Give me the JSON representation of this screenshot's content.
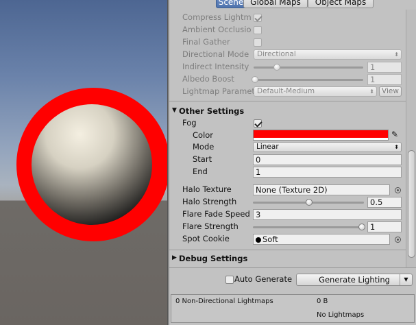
{
  "tabs": {
    "scene": "Scene",
    "global_maps": "Global Maps",
    "object_maps": "Object Maps"
  },
  "lightmapping": {
    "compress_lightmaps": {
      "label": "Compress Lightm",
      "checked": true
    },
    "ambient_occlusion": {
      "label": "Ambient Occlusio",
      "checked": false
    },
    "final_gather": {
      "label": "Final Gather",
      "checked": false
    },
    "directional_mode": {
      "label": "Directional Mode",
      "value": "Directional"
    },
    "indirect_intensity": {
      "label": "Indirect Intensity",
      "value": "1",
      "slider_fraction": 0.2
    },
    "albedo_boost": {
      "label": "Albedo Boost",
      "value": "1",
      "slider_fraction": 0.0
    },
    "lightmap_parameters": {
      "label": "Lightmap Paramet",
      "value": "Default-Medium",
      "view_button": "View"
    }
  },
  "other_settings": {
    "title": "Other Settings",
    "fog": {
      "label": "Fog",
      "checked": true
    },
    "color": {
      "label": "Color",
      "value": "#ff0000"
    },
    "mode": {
      "label": "Mode",
      "value": "Linear"
    },
    "start": {
      "label": "Start",
      "value": "0"
    },
    "end": {
      "label": "End",
      "value": "1"
    },
    "halo_texture": {
      "label": "Halo Texture",
      "value": "None (Texture 2D)"
    },
    "halo_strength": {
      "label": "Halo Strength",
      "value": "0.5",
      "slider_fraction": 0.5
    },
    "flare_fade_speed": {
      "label": "Flare Fade Speed",
      "value": "3"
    },
    "flare_strength": {
      "label": "Flare Strength",
      "value": "1",
      "slider_fraction": 1.0
    },
    "spot_cookie": {
      "label": "Spot Cookie",
      "value": "Soft"
    }
  },
  "debug_settings": {
    "title": "Debug Settings"
  },
  "footer": {
    "auto_generate": {
      "label": "Auto Generate",
      "checked": false
    },
    "generate_button": "Generate Lighting",
    "stats": {
      "non_directional": "0 Non-Directional Lightmaps",
      "size": "0 B",
      "lightmaps": "No Lightmaps"
    }
  },
  "colors": {
    "fog_color": "#ff0000",
    "active_tab": "#5a7db8"
  }
}
